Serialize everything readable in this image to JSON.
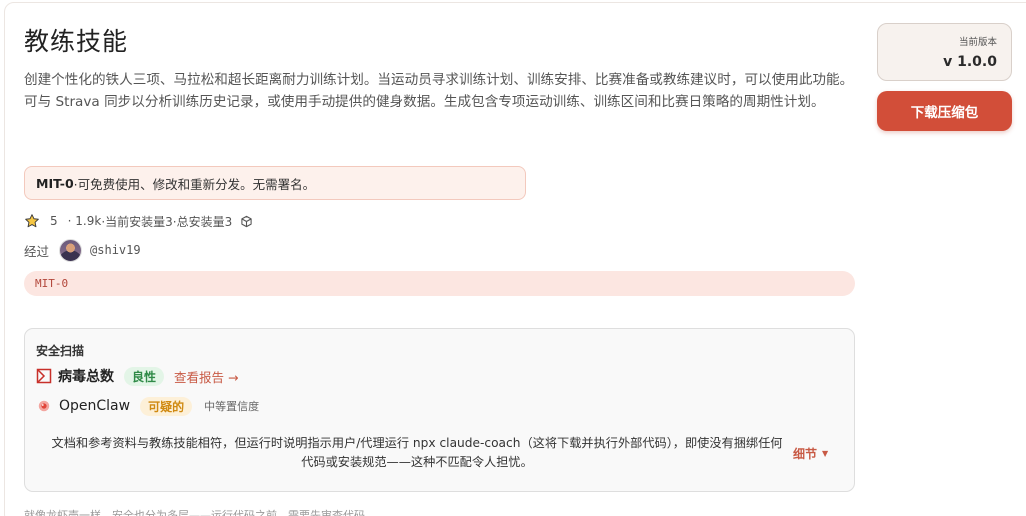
{
  "skill": {
    "title": "教练技能",
    "description": "创建个性化的铁人三项、马拉松和超长距离耐力训练计划。当运动员寻求训练计划、训练安排、比赛准备或教练建议时，可以使用此功能。可与 Strava 同步以分析训练历史记录，或使用手动提供的健身数据。生成包含专项运动训练、训练区间和比赛日策略的周期性计划。"
  },
  "license": {
    "name": "MIT-0",
    "note": "·可免费使用、修改和重新分发。无需署名。",
    "tag": "MIT-0"
  },
  "stats": {
    "rating": "5",
    "downloads": "· 1.9k",
    "current_installs": "·当前安装量3",
    "total_installs": "·总安装量3"
  },
  "author": {
    "prefix": "经过",
    "handle": "@shiv19"
  },
  "security": {
    "title": "安全扫描",
    "virustotal": {
      "name": "病毒总数",
      "status": "良性",
      "link": "查看报告 →"
    },
    "openclaw": {
      "name": "OpenClaw",
      "status": "可疑的",
      "confidence": "中等置信度",
      "summary": "文档和参考资料与教练技能相符，但运行时说明指示用户/代理运行 npx claude-coach（这将下载并执行外部代码），即使没有捆绑任何代码或安装规范——这种不匹配令人担忧。",
      "details_label": "细节"
    }
  },
  "footnote": "就像龙虾壳一样，安全也分为多层——运行代码之前，需要先审查代码。",
  "sidebar": {
    "version_label": "当前版本",
    "version_value": "v 1.0.0",
    "download_label": "下载压缩包"
  },
  "colors": {
    "accent": "#d24e39",
    "benign": "#2f8a47",
    "suspicious": "#d08a12"
  }
}
